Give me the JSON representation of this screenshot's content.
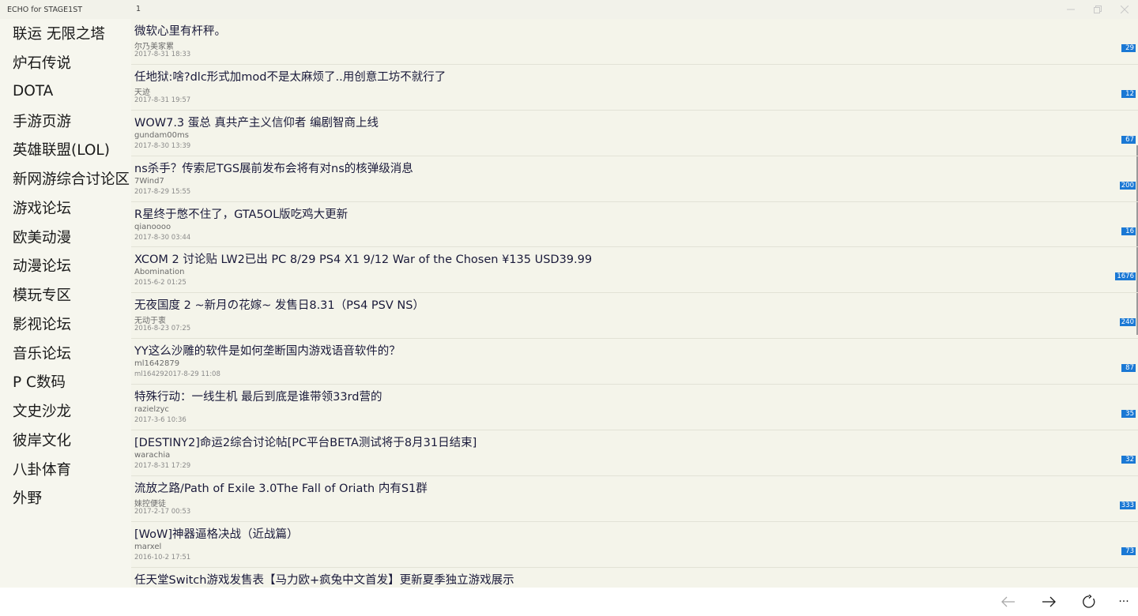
{
  "window": {
    "title": "ECHO for STAGE1ST",
    "page_number": "1"
  },
  "sidebar": {
    "items": [
      {
        "label": "联运 无限之塔"
      },
      {
        "label": "炉石传说"
      },
      {
        "label": "DOTA"
      },
      {
        "label": "手游页游"
      },
      {
        "label": "英雄联盟(LOL)"
      },
      {
        "label": "新网游综合讨论区"
      },
      {
        "label": "游戏论坛"
      },
      {
        "label": "欧美动漫"
      },
      {
        "label": "动漫论坛"
      },
      {
        "label": "模玩专区"
      },
      {
        "label": "影视论坛"
      },
      {
        "label": "音乐论坛"
      },
      {
        "label": " P C数码"
      },
      {
        "label": "文史沙龙"
      },
      {
        "label": "彼岸文化"
      },
      {
        "label": "八卦体育"
      },
      {
        "label": "外野"
      }
    ]
  },
  "threads": [
    {
      "title": "微软心里有杆秤。",
      "author": "尔乃美家累",
      "date": "2017-8-31 18:33",
      "replies": "29"
    },
    {
      "title": "任地狱:啥?dlc形式加mod不是太麻烦了..用创意工坊不就行了",
      "author": "天迹",
      "date": "2017-8-31 19:57",
      "replies": "12"
    },
    {
      "title": "WOW7.3 蛋总 真共产主义信仰者 编剧智商上线",
      "author": "gundam00ms",
      "date": "2017-8-30 13:39",
      "replies": "67"
    },
    {
      "title": "ns杀手？传索尼TGS展前发布会将有对ns的核弹级消息",
      "author": "7Wind7",
      "date": "2017-8-29 15:55",
      "replies": "200"
    },
    {
      "title": "R星终于憋不住了，GTA5OL版吃鸡大更新",
      "author": "qianoooo",
      "date": "2017-8-30 03:44",
      "replies": "16"
    },
    {
      "title": "XCOM 2 讨论贴 LW2已出 PC 8/29 PS4 X1 9/12 War of the Chosen ¥135 USD39.99",
      "author": "Abomination",
      "date": "2015-6-2 01:25",
      "replies": "1676"
    },
    {
      "title": "无夜国度 2 ~新月の花嫁~ 发售日8.31（PS4 PSV NS）",
      "author": "无动于衷",
      "date": "2016-8-23 07:25",
      "replies": "240"
    },
    {
      "title": "YY这么沙雕的软件是如何垄断国内游戏语音软件的？",
      "author": "ml1642879",
      "date": "ml16429​2017-8-29 11:08",
      "replies": "87"
    },
    {
      "title": "特殊行动：一线生机 最后到底是谁带领33rd营的",
      "author": "razielzyc",
      "date": "2017-3-6 10:36",
      "replies": "35"
    },
    {
      "title": "[DESTINY2]命运2综合讨论帖[PC平台BETA测试将于8月31日结束]",
      "author": "warachia",
      "date": "2017-8-31 17:29",
      "replies": "32"
    },
    {
      "title": "流放之路/Path of Exile 3.0The Fall of Oriath  内有S1群",
      "author": "妹控便徒",
      "date": "2017-2-17 00:53",
      "replies": "333"
    },
    {
      "title": "[WoW]神器逼格决战（近战篇）",
      "author": "marxel",
      "date": "2016-10-2 17:51",
      "replies": "73"
    },
    {
      "title": "任天堂Switch游戏发售表【马力欧+疯兔中文首发】更新夏季独立游戏展示",
      "author": "",
      "date": "",
      "replies": ""
    }
  ],
  "bottom_bar": {
    "back_icon": "arrow-left-icon",
    "forward_icon": "arrow-right-icon",
    "refresh_icon": "refresh-icon",
    "more_icon": "more-icon",
    "more_label": "···"
  },
  "colors": {
    "background": "#f6f6ee",
    "badge": "#1a78d4",
    "divider": "#e2e2d6"
  }
}
